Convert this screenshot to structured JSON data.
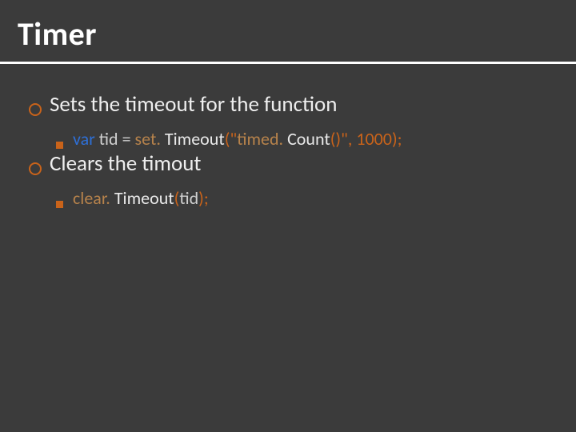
{
  "title": "Timer",
  "items": [
    {
      "text": "Sets the timeout for the function",
      "children": [
        {
          "segments": [
            {
              "cls": "code-kw",
              "t": "var "
            },
            {
              "cls": "code-dim",
              "t": "tid "
            },
            {
              "cls": "code-op",
              "t": "= "
            },
            {
              "cls": "code-fn",
              "t": "set. "
            },
            {
              "cls": "code-norm",
              "t": "Timeout"
            },
            {
              "cls": "code-paren",
              "t": "(\""
            },
            {
              "cls": "code-fn",
              "t": "timed. "
            },
            {
              "cls": "code-norm",
              "t": "Count"
            },
            {
              "cls": "code-paren",
              "t": "()\""
            },
            {
              "cls": "code-paren",
              "t": ", 1000);"
            }
          ]
        }
      ]
    },
    {
      "text": "Clears the timout",
      "children": [
        {
          "segments": [
            {
              "cls": "code-fn",
              "t": "clear. "
            },
            {
              "cls": "code-norm",
              "t": "Timeout"
            },
            {
              "cls": "code-paren",
              "t": "("
            },
            {
              "cls": "code-dim",
              "t": "tid"
            },
            {
              "cls": "code-paren",
              "t": ");"
            }
          ]
        }
      ]
    }
  ]
}
